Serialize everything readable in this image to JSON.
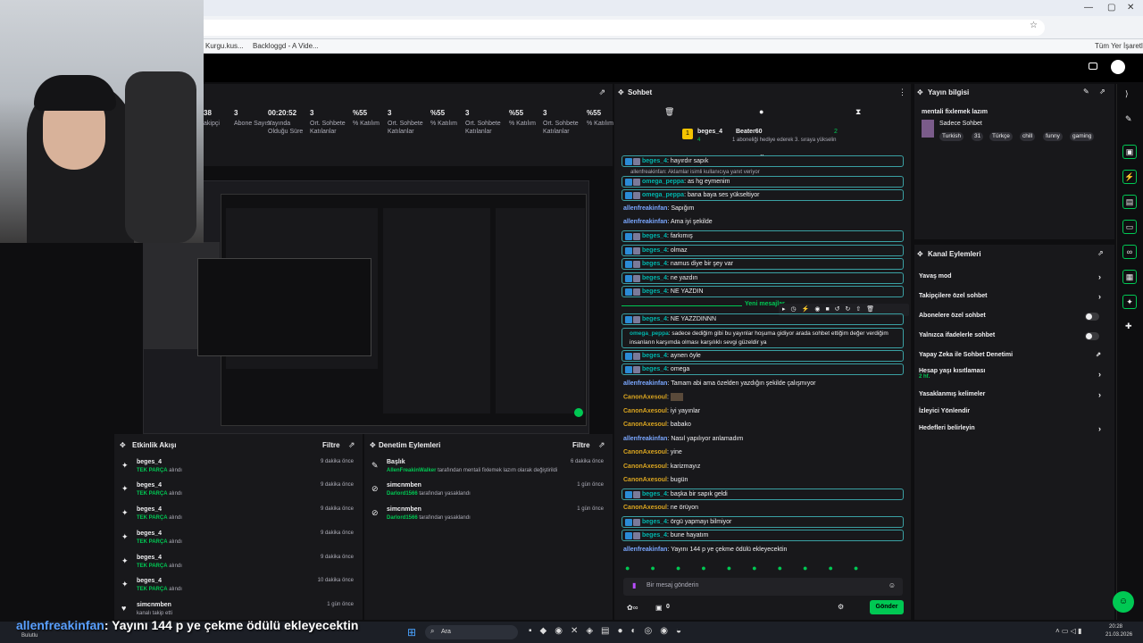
{
  "browser": {
    "bookmarks": [
      "Kurgu.kus...",
      "Backloggd - A Vide..."
    ],
    "all_bookmarks_label": "Tüm Yer İşaretleri"
  },
  "stats": [
    {
      "value": "38",
      "label": "akipçi"
    },
    {
      "value": "3",
      "label": "Abone Sayısı"
    },
    {
      "value": "00:20:52",
      "label": "Yayında Olduğu Süre"
    },
    {
      "value": "3",
      "label": "Ort. Sohbete Katılanlar"
    },
    {
      "value": "%55",
      "label": "% Katılım"
    },
    {
      "value": "3",
      "label": "Ort. Sohbete Katılanlar"
    },
    {
      "value": "%55",
      "label": "% Katılım"
    },
    {
      "value": "3",
      "label": "Ort. Sohbete Katılanlar"
    },
    {
      "value": "%55",
      "label": "% Katılım"
    },
    {
      "value": "3",
      "label": "Ort. Sohbete Katılanlar"
    },
    {
      "value": "%55",
      "label": "% Katılım"
    }
  ],
  "activity": {
    "title": "Etkinlik Akışı",
    "filter": "Filtre",
    "items": [
      {
        "user": "beges_4",
        "highlight": "TEK PARÇA",
        "suffix": "alındı",
        "time": "9 dakika önce"
      },
      {
        "user": "beges_4",
        "highlight": "TEK PARÇA",
        "suffix": "alındı",
        "time": "9 dakika önce"
      },
      {
        "user": "beges_4",
        "highlight": "TEK PARÇA",
        "suffix": "alındı",
        "time": "9 dakika önce"
      },
      {
        "user": "beges_4",
        "highlight": "TEK PARÇA",
        "suffix": "alındı",
        "time": "9 dakika önce"
      },
      {
        "user": "beges_4",
        "highlight": "TEK PARÇA",
        "suffix": "alındı",
        "time": "9 dakika önce"
      },
      {
        "user": "beges_4",
        "highlight": "TEK PARÇA",
        "suffix": "alındı",
        "time": "10 dakika önce"
      },
      {
        "user": "simcnmben",
        "highlight": "",
        "suffix": "kanalı takip etti",
        "time": "1 gün önce"
      }
    ]
  },
  "moderation": {
    "title": "Denetim Eylemleri",
    "filter": "Filtre",
    "items": [
      {
        "title": "Başlık",
        "actor": "AllenFreakinWalker",
        "text": "tarafından mentali fixlemek lazım olarak değiştirildi",
        "time": "6 dakika önce"
      },
      {
        "title": "simcnmben",
        "actor": "Darlord1566",
        "text": "tarafından yasaklandı",
        "time": "1 gün önce"
      },
      {
        "title": "simcnmben",
        "actor": "Darlord1566",
        "text": "tarafından yasaklandı",
        "time": "1 gün önce"
      }
    ]
  },
  "chat": {
    "title": "Sohbet",
    "hype": {
      "user": "beges_4",
      "count": "4",
      "gifter": "Beater60",
      "gifter_count": "2",
      "note": "1 aboneliği hediye ederek 3. sıraya yükselin"
    },
    "new_messages": "Yeni mesajlar",
    "messages": [
      {
        "user": "beges_4",
        "text": "hayırdır sapık",
        "color": "#00b5ad",
        "hl": true
      },
      {
        "user": "",
        "text": "allenfreakinfan: Aklamlar isimli kullanıcıya yanıt veriyor",
        "color": "#adadb8",
        "hl": false
      },
      {
        "user": "omega_peppa",
        "text": "as hg eymenim",
        "color": "#00b5ad",
        "hl": true
      },
      {
        "user": "omega_peppa",
        "text": "bana baya ses yükseltiyor",
        "color": "#00b5ad",
        "hl": true
      },
      {
        "user": "allenfreakinfan",
        "text": "Sapığım",
        "color": "#7aa7ff",
        "hl": false
      },
      {
        "user": "allenfreakinfan",
        "text": "Ama iyi şekilde",
        "color": "#7aa7ff",
        "hl": false
      },
      {
        "user": "beges_4",
        "text": "farkımış",
        "color": "#00b5ad",
        "hl": true
      },
      {
        "user": "beges_4",
        "text": "olmaz",
        "color": "#00b5ad",
        "hl": true
      },
      {
        "user": "beges_4",
        "text": "namus diye bir şey var",
        "color": "#00b5ad",
        "hl": true
      },
      {
        "user": "beges_4",
        "text": "ne yazdın",
        "color": "#00b5ad",
        "hl": true
      },
      {
        "user": "beges_4",
        "text": "NE YAZDIN",
        "color": "#00b5ad",
        "hl": true
      },
      {
        "user": "beges_4",
        "text": "NE YAZZDINNN",
        "color": "#00b5ad",
        "hl": true
      },
      {
        "user": "omega_peppa",
        "text": "sadece dediğim gibi bu yayınlar hoşuma gidiyor arada sohbet ettiğim değer verdiğim insanların karşımda olması karşılıklı sevgi güzeldir ya",
        "color": "#00b5ad",
        "hl": true
      },
      {
        "user": "beges_4",
        "text": "aynen öyle",
        "color": "#00b5ad",
        "hl": true
      },
      {
        "user": "beges_4",
        "text": "omega",
        "color": "#00b5ad",
        "hl": true
      },
      {
        "user": "allenfreakinfan",
        "text": "Tamam abi ama özelden yazdığın şekilde çalışmıyor",
        "color": "#7aa7ff",
        "hl": false
      },
      {
        "user": "CanonAxesoul",
        "text": "",
        "color": "#daa520",
        "hl": false
      },
      {
        "user": "CanonAxesoul",
        "text": "iyi yayınlar",
        "color": "#daa520",
        "hl": false
      },
      {
        "user": "CanonAxesoul",
        "text": "babako",
        "color": "#daa520",
        "hl": false
      },
      {
        "user": "allenfreakinfan",
        "text": "Nasıl yapılıyor anlamadım",
        "color": "#7aa7ff",
        "hl": false
      },
      {
        "user": "CanonAxesoul",
        "text": "yine",
        "color": "#daa520",
        "hl": false
      },
      {
        "user": "CanonAxesoul",
        "text": "karizmayız",
        "color": "#daa520",
        "hl": false
      },
      {
        "user": "CanonAxesoul",
        "text": "bugün",
        "color": "#daa520",
        "hl": false
      },
      {
        "user": "beges_4",
        "text": "başka bir sapık geldi",
        "color": "#00b5ad",
        "hl": true
      },
      {
        "user": "CanonAxesoul",
        "text": "ne örüyon",
        "color": "#daa520",
        "hl": false
      },
      {
        "user": "beges_4",
        "text": "örgü yapmayı bilmiyor",
        "color": "#00b5ad",
        "hl": true
      },
      {
        "user": "beges_4",
        "text": "bune hayatım",
        "color": "#00b5ad",
        "hl": true
      },
      {
        "user": "allenfreakinfan",
        "text": "Yayını 144 p ye çekme ödülü ekleyecektin",
        "color": "#7aa7ff",
        "hl": false
      }
    ],
    "input_placeholder": "Bir mesaj gönderin",
    "points": "0",
    "send_label": "Gönder"
  },
  "stream_info": {
    "title": "Yayın bilgisi",
    "stream_title": "mentali fixlemek lazım",
    "category": "Sadece Sohbet",
    "tags": [
      "Turkish",
      "31",
      "Türkçe",
      "chill",
      "funny",
      "gaming"
    ]
  },
  "channel_actions": {
    "title": "Kanal Eylemleri",
    "items": [
      {
        "label": "Yavaş mod",
        "control": "arrow"
      },
      {
        "label": "Takipçilere özel sohbet",
        "control": "arrow"
      },
      {
        "label": "Abonelere özel sohbet",
        "control": "toggle"
      },
      {
        "label": "Yalnızca ifadelerle sohbet",
        "control": "toggle"
      },
      {
        "label": "Yapay Zeka ile Sohbet Denetimi",
        "control": "external"
      },
      {
        "label": "Hesap yaşı kısıtlaması",
        "sub": "2 hf.",
        "control": "arrow"
      },
      {
        "label": "Yasaklanmış kelimeler",
        "control": "arrow"
      },
      {
        "label": "İzleyici Yönlendir",
        "control": ""
      },
      {
        "label": "Hedefleri belirleyin",
        "control": "arrow"
      }
    ]
  },
  "caption": {
    "user": "allenfreakinfan",
    "text": ": Yayını 144 p ye çekme ödülü ekleyecektin"
  },
  "taskbar": {
    "weather": "Bulutlu",
    "search": "Ara",
    "time": "20:28",
    "date": "21.03.2026"
  },
  "colors": {
    "accent": "#00c853",
    "teal": "#3aa0a3",
    "bg": "#0e0e10",
    "panel": "#18181b"
  }
}
